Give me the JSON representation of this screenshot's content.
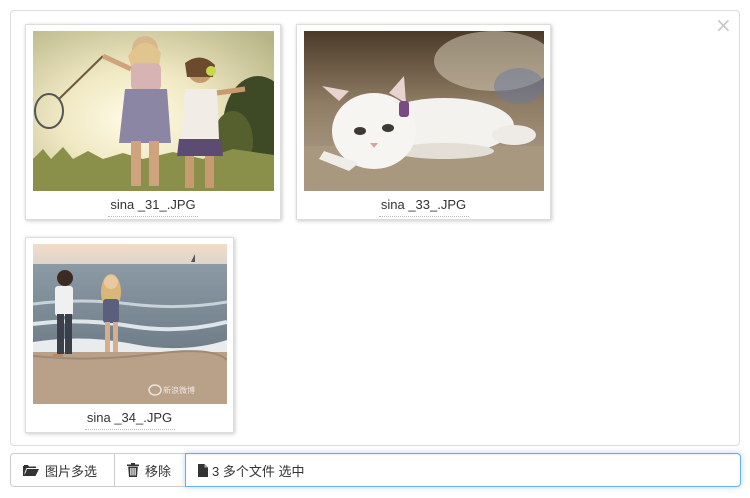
{
  "preview": {
    "close_glyph": "×",
    "files": [
      {
        "name": "sina _31_.JPG",
        "image": "two girls in sunny field with butterfly net"
      },
      {
        "name": "sina _33_.JPG",
        "image": "white cat lying on pavement"
      },
      {
        "name": "sina _34_.JPG",
        "image": "couple standing on beach by the sea"
      }
    ],
    "watermark_text": "新浪微博"
  },
  "toolbar": {
    "browse_label": "图片多选",
    "browse_icon": "folder-open-icon",
    "remove_label": "移除",
    "remove_icon": "trash-icon",
    "file_icon": "file-icon",
    "caption_text": "3 多个文件 选中"
  },
  "colors": {
    "focus_border": "#66afe9",
    "panel_border": "#dcdcdc",
    "button_border": "#cccccc"
  }
}
